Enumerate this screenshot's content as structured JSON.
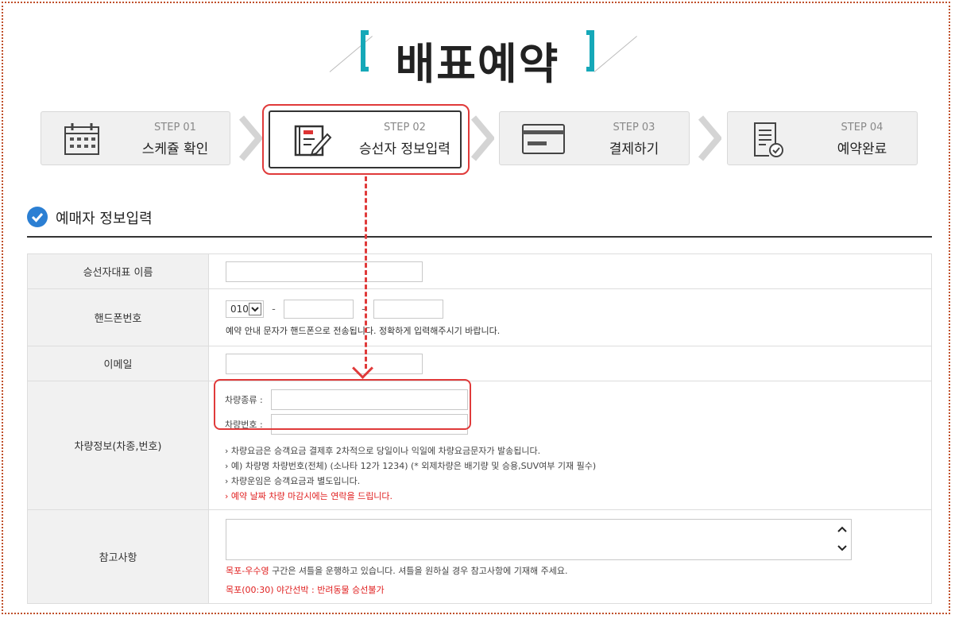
{
  "page_title": "배표예약",
  "steps": [
    {
      "num": "STEP 01",
      "label": "스케쥴 확인",
      "icon": "calendar-icon"
    },
    {
      "num": "STEP 02",
      "label": "승선자 정보입력",
      "icon": "edit-document-icon"
    },
    {
      "num": "STEP 03",
      "label": "결제하기",
      "icon": "credit-card-icon"
    },
    {
      "num": "STEP 04",
      "label": "예약완료",
      "icon": "receipt-check-icon"
    }
  ],
  "section": {
    "title": "예매자 정보입력",
    "icon": "check-circle-icon"
  },
  "form": {
    "name_label": "승선자대표 이름",
    "name_value": "",
    "phone_label": "핸드폰번호",
    "phone_prefix": "010",
    "phone_dash": "-",
    "phone_mid": "",
    "phone_last": "",
    "phone_note": "예약 안내 문자가 핸드폰으로 전송됩니다. 정확하게 입력해주시기 바랍니다.",
    "email_label": "이메일",
    "email_value": "",
    "vehicle_label": "차량정보(차종,번호)",
    "vehicle_type_label": "차량종류 :",
    "vehicle_type_value": "",
    "vehicle_num_label": "차량번호 :",
    "vehicle_num_value": "",
    "vehicle_notes": [
      "차량요금은 승객요금 결제후 2차적으로 당일이나 익일에 차량요금문자가 발송됩니다.",
      "예) 차량명 차량번호(전체) (소나타 12가 1234) (* 외제차량은 배기량 및 승용,SUV여부 기재 필수)",
      "차량운임은 승객요금과 별도입니다."
    ],
    "vehicle_notice": "예약 날짜 차량 마감시에는 연락을 드립니다.",
    "memo_label": "참고사항",
    "memo_value": "",
    "memo_note_red": "목포-우수영",
    "memo_note_rest": " 구간은 셔틀을 운행하고 있습니다. 셔틀을 원하실 경우 참고사항에 기재해 주세요.",
    "memo_notice": "목포(00:30) 야간선박 : 반려동물 승선불가"
  },
  "colors": {
    "accent": "#15a8b8",
    "highlight": "#e03a3a",
    "check": "#2b7fd3",
    "notice": "#e02020"
  }
}
